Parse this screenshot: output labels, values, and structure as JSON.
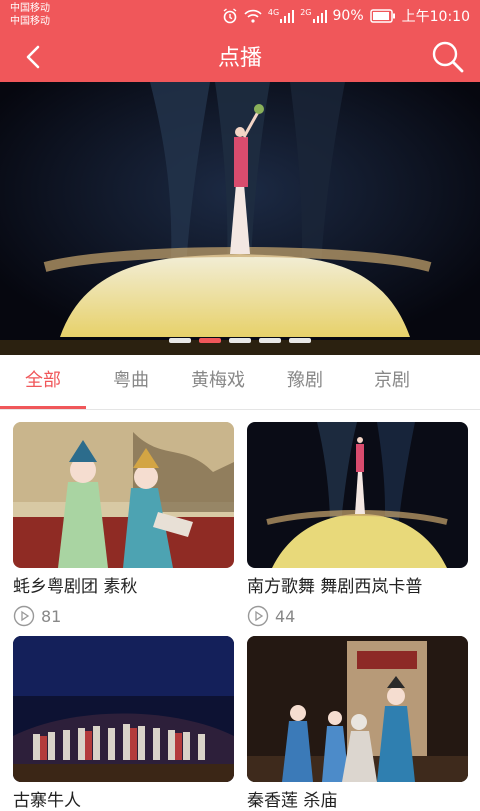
{
  "status": {
    "carrier1": "中国移动",
    "carrier2": "中国移动",
    "battery": "90%",
    "time": "上午10:10",
    "net1": "4G",
    "net2": "2G"
  },
  "nav": {
    "title": "点播"
  },
  "banner": {
    "slide_count": 5,
    "active_index": 1
  },
  "tabs": [
    "全部",
    "粤曲",
    "黄梅戏",
    "豫剧",
    "京剧"
  ],
  "active_tab": 0,
  "videos": [
    {
      "title": "蚝乡粤剧团 素秋",
      "plays": "81"
    },
    {
      "title": "南方歌舞 舞剧西岚卡普",
      "plays": "44"
    },
    {
      "title": "古寨牛人",
      "plays": ""
    },
    {
      "title": "秦香莲 杀庙",
      "plays": ""
    }
  ],
  "colors": {
    "accent": "#f0575a",
    "muted": "#888888"
  }
}
